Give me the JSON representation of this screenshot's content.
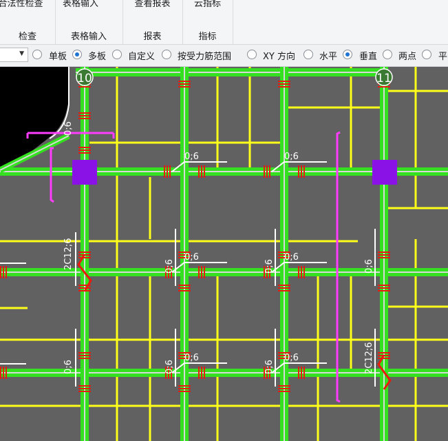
{
  "ribbon": {
    "groups": [
      {
        "button": "合法性检查",
        "label": "检查"
      },
      {
        "button": "表格输入",
        "label": "表格输入"
      },
      {
        "button": "查看报表",
        "label": "报表"
      },
      {
        "button": "云指标",
        "label": "指标"
      }
    ]
  },
  "options": {
    "combo_value": "",
    "radios": [
      {
        "label": "单板",
        "checked": false
      },
      {
        "label": "多板",
        "checked": true
      },
      {
        "label": "自定义",
        "checked": false
      },
      {
        "label": "按受力筋范围",
        "checked": false
      },
      {
        "label": "XY 方向",
        "checked": false
      },
      {
        "label": "水平",
        "checked": false
      },
      {
        "label": "垂直",
        "checked": true
      },
      {
        "label": "两点",
        "checked": false
      },
      {
        "label": "平",
        "checked": false
      }
    ]
  },
  "drawing": {
    "axis_labels": [
      "10",
      "11"
    ],
    "rebar_labels": {
      "small": "0;6",
      "long": "2C12;6"
    },
    "colors": {
      "background": "#616161",
      "beam": "#34e01f",
      "rebar": "#ffff1a",
      "column": "#8a12e6",
      "magenta": "#ff3cff",
      "red_marks": "#e81c0c",
      "void": "#000000"
    }
  }
}
